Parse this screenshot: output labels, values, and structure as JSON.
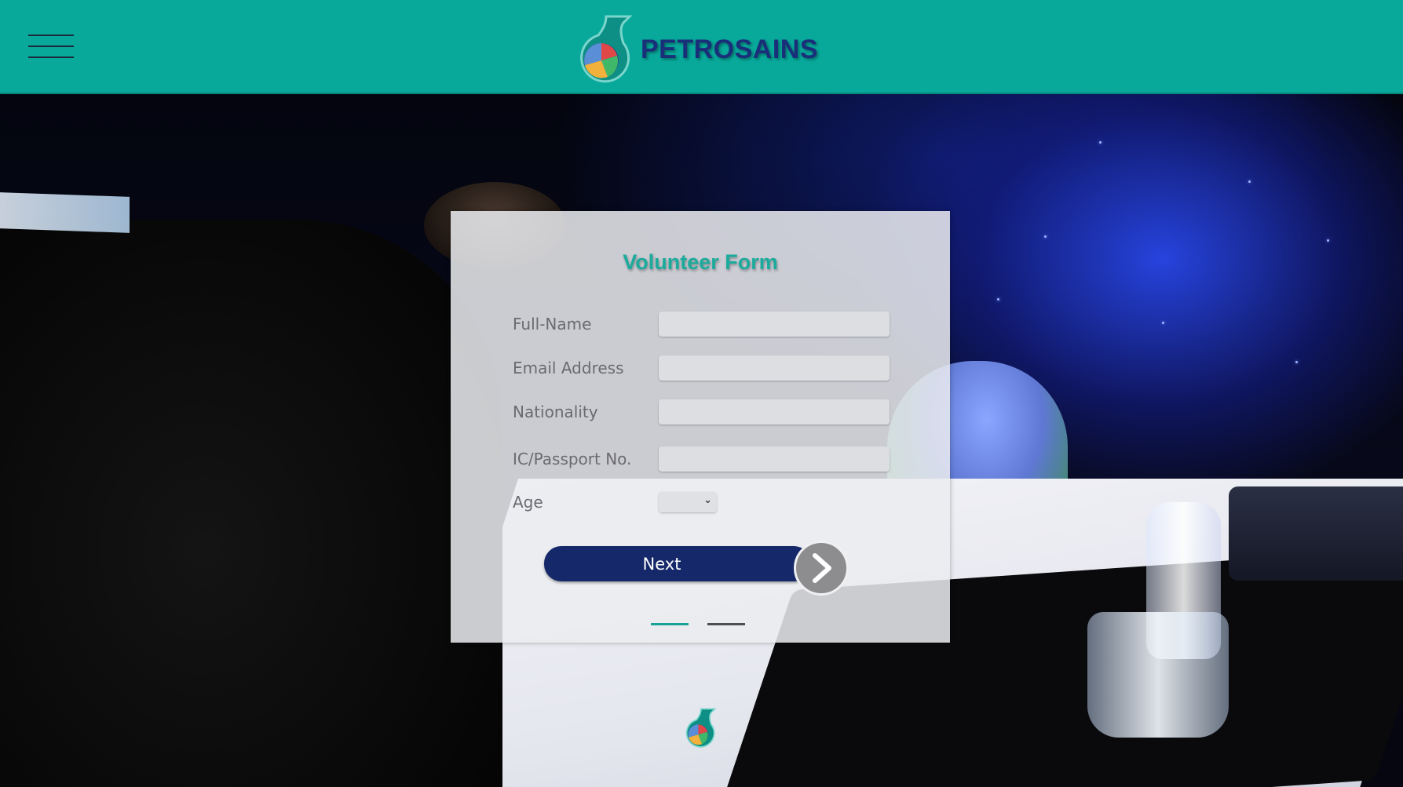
{
  "header": {
    "brand": "PETROSAINS",
    "menu_icon": "hamburger-menu-icon",
    "logo_icon": "petrosains-drop-icon"
  },
  "form": {
    "title": "Volunteer Form",
    "fields": [
      {
        "label": "Full-Name",
        "value": ""
      },
      {
        "label": "Email Address",
        "value": ""
      },
      {
        "label": "Nationality",
        "value": ""
      },
      {
        "label": "IC/Passport No.",
        "value": ""
      }
    ],
    "age": {
      "label": "Age",
      "value": ""
    },
    "next_label": "Next",
    "next_icon": "chevron-right-icon",
    "steps": {
      "current": 1,
      "total": 2
    }
  },
  "footer": {
    "logo_icon": "petrosains-drop-icon"
  },
  "colors": {
    "header_bg": "#08a99b",
    "title": "#1bab9c",
    "button": "#15286a",
    "brand_text": "#1a2f7a"
  }
}
